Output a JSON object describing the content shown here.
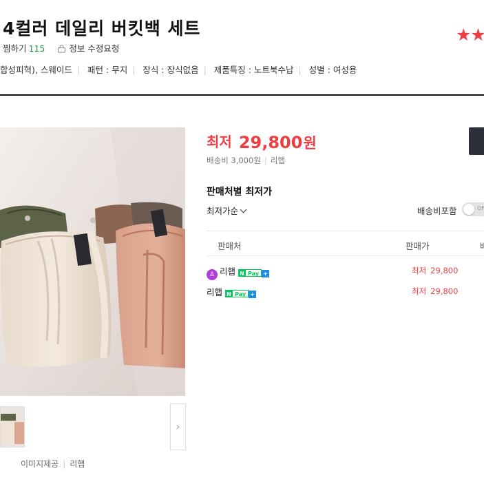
{
  "product": {
    "title": "4컬러 데일리 버킷백 세트",
    "stars": "★★",
    "wish_label": "찜하기",
    "wish_count": "115",
    "edit_request": "정보 수정요청",
    "specs": [
      "합성피혁), 스웨이드",
      "패턴 : 무지",
      "장식 : 장식없음",
      "제품특징 : 노트북수납",
      "성별 : 여성용"
    ]
  },
  "gallery": {
    "credit_label": "이미지제공",
    "credit_seller": "리햅",
    "next_icon": "chevron-right-icon"
  },
  "price": {
    "label": "최저",
    "value": "29,800",
    "unit": "원",
    "shipping": "배송비 3,000원",
    "seller": "리햅"
  },
  "offers": {
    "title": "판매처별 최저가",
    "sort_label": "최저가순",
    "shipping_toggle_label": "배송비포함",
    "toggle_text": "OFF",
    "columns": [
      "판매처",
      "판매가",
      "배"
    ],
    "rows": [
      {
        "seller": "리햅",
        "has_icon": true,
        "price_label": "최저",
        "price": "29,800"
      },
      {
        "seller": "리햅",
        "has_icon": false,
        "price_label": "최저",
        "price": "29,800"
      }
    ],
    "npay": {
      "n": "N",
      "pay": "Pay",
      "plus": "+"
    }
  },
  "colors": {
    "accent_red": "#ef3e42",
    "npay_green": "#03c75a",
    "dark_button": "#2d2f3b"
  }
}
